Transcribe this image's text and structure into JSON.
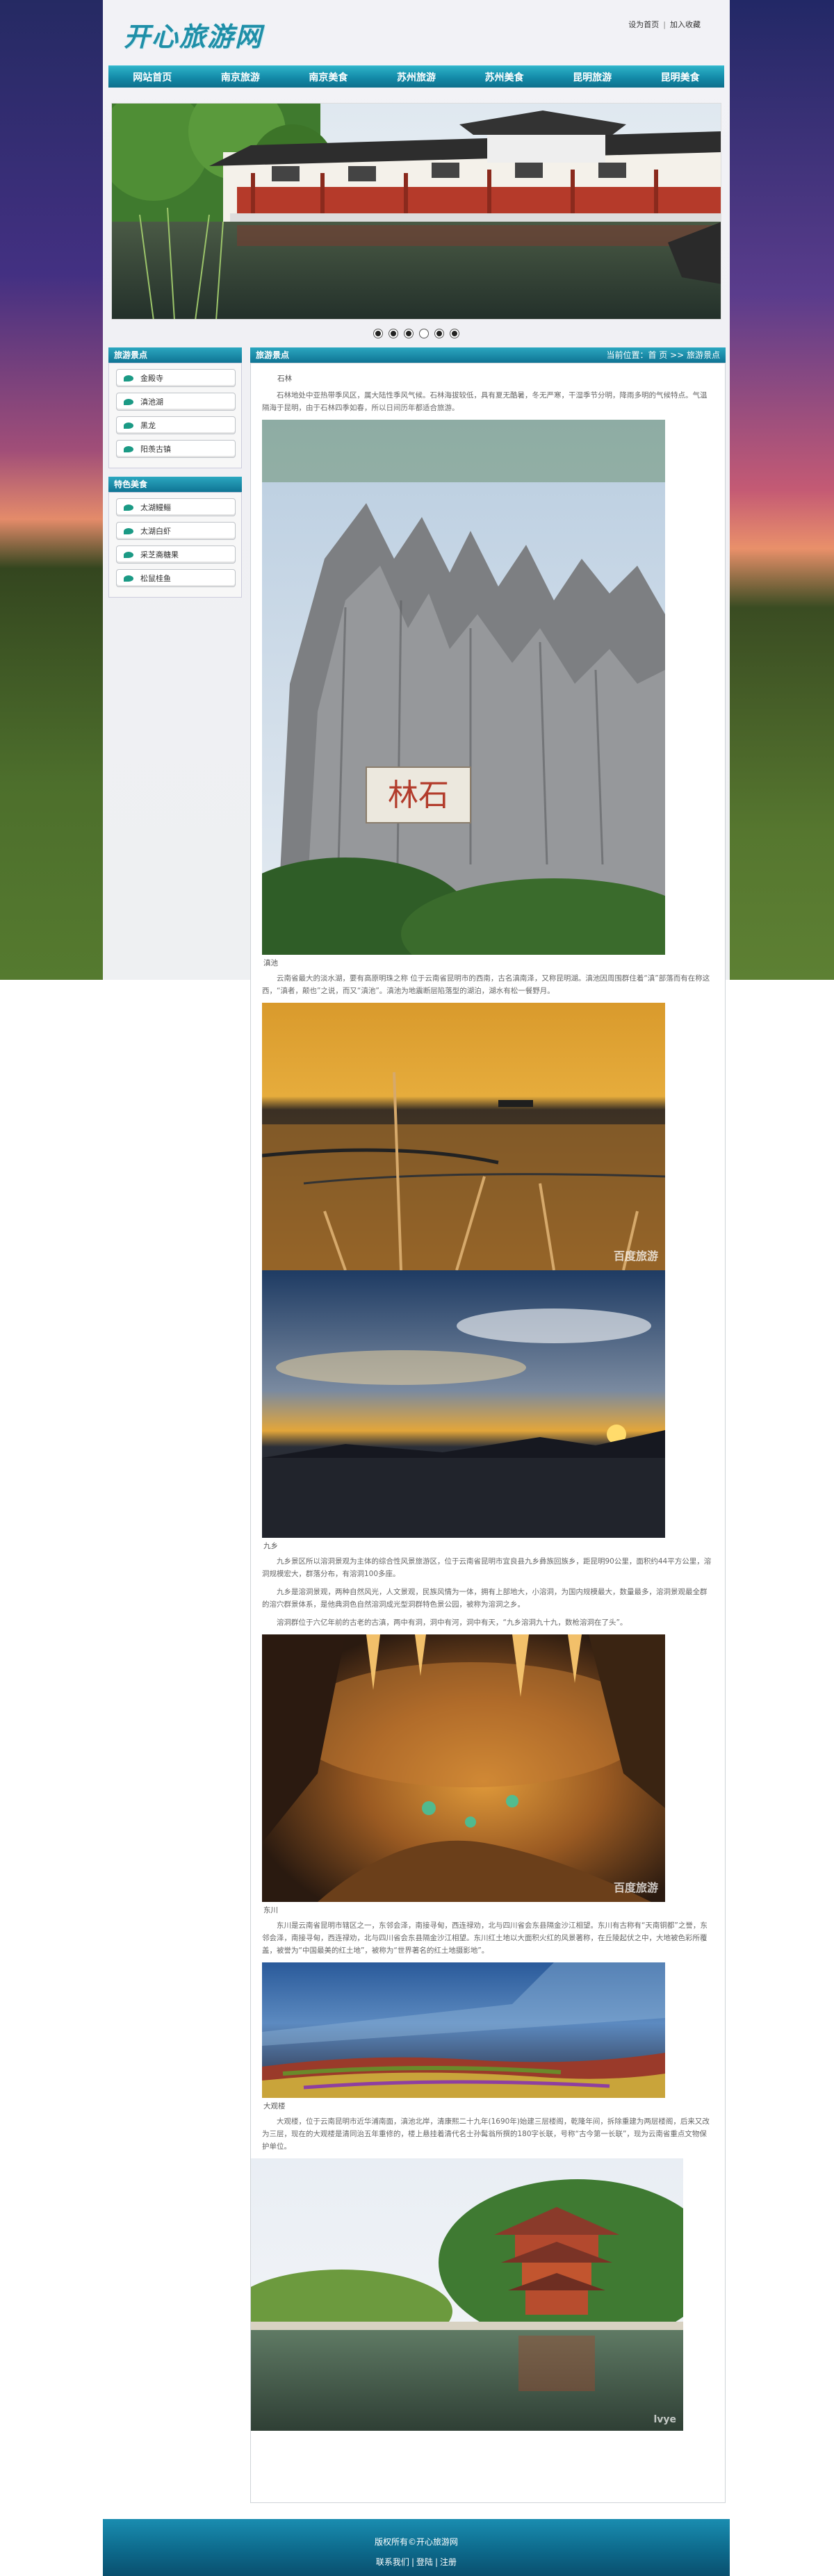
{
  "site": {
    "logo": "开心旅游网"
  },
  "top_links": {
    "home": "设为首页",
    "fav": "加入收藏",
    "sep": "|"
  },
  "nav": [
    "网站首页",
    "南京旅游",
    "南京美食",
    "苏州旅游",
    "苏州美食",
    "昆明旅游",
    "昆明美食"
  ],
  "sidebar": {
    "scenic_title": "旅游景点",
    "scenic_items": [
      "金殿寺",
      "滇池湖",
      "黑龙",
      "阳羡古镇"
    ],
    "food_title": "特色美食",
    "food_items": [
      "太湖鳗鲡",
      "太湖白虾",
      "采芝斋糖果",
      "松鼠桂鱼"
    ]
  },
  "main": {
    "title": "旅游景点",
    "breadcrumb": "当前位置：首 页 >> 旅游景点",
    "heading": "石林",
    "intro": "石林地处中亚热带季风区，属大陆性季风气候。石林海拔较低，具有夏无酷暑，冬无严寒，干湿季节分明，降雨多明的气候特点。气温隔海于昆明，由于石林四季如春，所以日间历年都适合旅游。",
    "cap_stone": "滇池",
    "dianchi_text": "云南省最大的淡水湖，要有高原明珠之称 位于云南省昆明市的西南，古名滇南泽，又称昆明湖。滇池因周围群住着“滇”部落而有在称这西，“滇者，颠也”之说，而又“滇池”。滇池为地震断层陷落型的湖泊，湖水有松一餐野月。",
    "cap_jiuxiang": "九乡",
    "jiuxiang_text1": "九乡景区所以溶洞景观为主体的综合性风景旅游区，位于云南省昆明市宜良县九乡彝族回族乡，距昆明90公里，面积约44平方公里，溶洞规模宏大，群落分布，有溶洞100多座。",
    "jiuxiang_text2": "九乡是溶洞景观，两种自然风光，人文景观，民族风情为一体，拥有上部地大，小溶洞，为国内规模最大，数量最多，溶洞景观最全群的溶穴群景体系，是他典洞色自然溶洞成光型洞群特色景公园，被称为溶洞之乡。",
    "jiuxiang_text3": "溶洞群位于六亿年前的古老的古滇，两中有洞，洞中有河，洞中有天，“九乡溶洞九十九，数枪溶洞在了头”。",
    "cap_dongchuan": "东川",
    "dongchuan_text": "东川是云南省昆明市辖区之一，东邻会泽，南接寻甸，西连禄劝，北与四川省会东县隔金沙江相望。东川有古称有“天南铜都”之誉，东邻会泽，南接寻甸，西连禄劝，北与四川省会东县隔金沙江相望。东川红土地以大面积火红的风景著称，在丘陵起伏之中，大地被色彩所覆盖，被誉为“中国最美的红土地”，被称为“世界著名的红土地摄影地”。",
    "cap_daguan": "大观楼",
    "daguan_text": "大观楼，位于云南昆明市近华浦南面，滇池北岸，清康熙二十九年(1690年)始建三层楼阁，乾隆年间，拆除重建为两层楼阁，后来又改为三层，现在的大观楼是清同治五年重修的，楼上悬挂着清代名士孙髯翁所撰的180字长联，号称“古今第一长联”，现为云南省重点文物保护单位。"
  },
  "footer": {
    "copyright": "版权所有©开心旅游网",
    "links": [
      "联系我们",
      "登陆",
      "注册"
    ],
    "sep": "|"
  },
  "banner_dots": 6,
  "banner_active": 3
}
